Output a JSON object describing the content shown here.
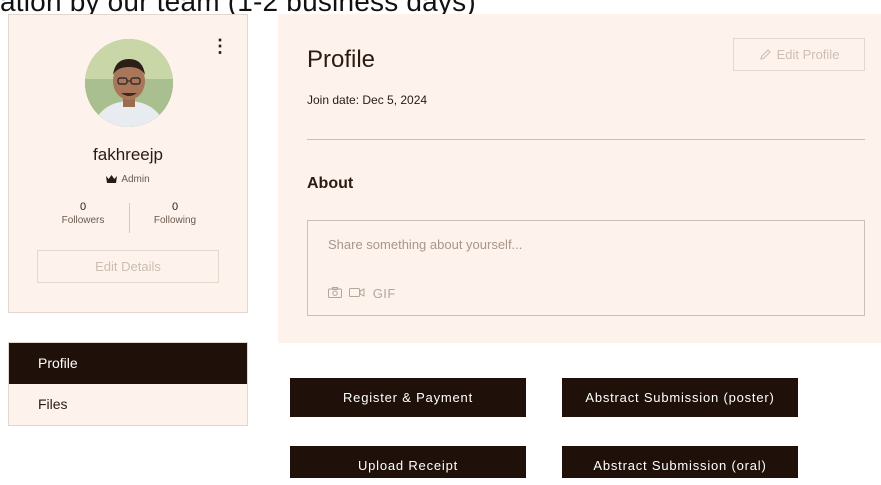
{
  "banner": {
    "text": "ation by our team (1-2 business days)"
  },
  "sidebar_card": {
    "username": "fakhreejp",
    "role": "Admin",
    "followers_count": "0",
    "followers_label": "Followers",
    "following_count": "0",
    "following_label": "Following",
    "edit_details_label": "Edit Details"
  },
  "nav": {
    "items": [
      {
        "label": "Profile",
        "active": true
      },
      {
        "label": "Files",
        "active": false
      }
    ]
  },
  "profile": {
    "title": "Profile",
    "join_date": "Join date: Dec 5, 2024",
    "edit_profile_label": "Edit Profile",
    "about_heading": "About",
    "composer_placeholder": "Share something about yourself...",
    "gif_label": "GIF"
  },
  "actions": {
    "register_payment": "Register & Payment",
    "abstract_poster": "Abstract Submission (poster)",
    "upload_receipt": "Upload Receipt",
    "abstract_oral": "Abstract Submission (oral)"
  },
  "colors": {
    "card_bg": "#fdf3ec",
    "dark": "#1f100a",
    "muted_border": "#e3d6cc"
  },
  "icons": [
    "kebab-icon",
    "crown-icon",
    "pencil-icon",
    "camera-icon",
    "video-icon"
  ]
}
